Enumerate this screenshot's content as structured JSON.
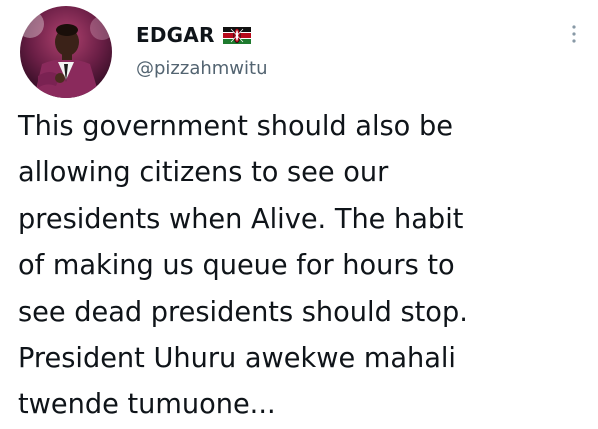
{
  "tweet": {
    "display_name": "EDGAR",
    "handle": "@pizzahmwitu",
    "text_lines": [
      "This government should also be",
      "allowing citizens to see our",
      "presidents when Alive. The habit",
      "of making us queue for hours to",
      "see dead presidents should stop.",
      "President Uhuru awekwe mahali",
      "twende tumuone..."
    ]
  },
  "icons": {
    "flag": "kenya-flag-emoji",
    "more": "more-options-icon"
  }
}
